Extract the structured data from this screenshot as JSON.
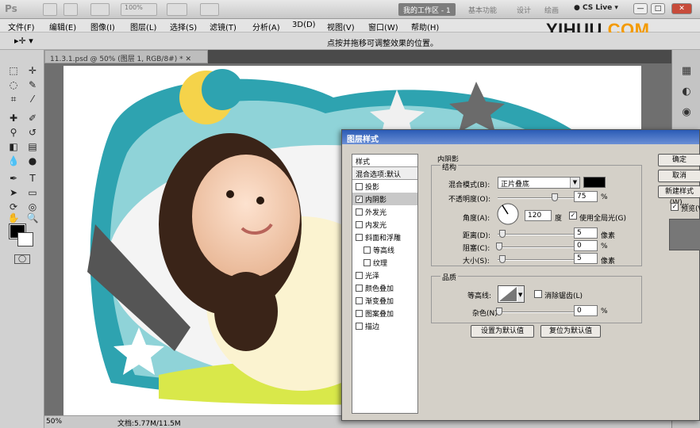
{
  "app": {
    "logo": "Ps",
    "zoom_box": "100%"
  },
  "workspaces": [
    "我的工作区 - 1",
    "基本功能",
    "设计",
    "绘画"
  ],
  "cslive": "CS Live",
  "window_buttons": [
    "—",
    "□",
    "✕"
  ],
  "menu": [
    "文件(F)",
    "编辑(E)",
    "图像(I)",
    "图层(L)",
    "选择(S)",
    "滤镜(T)",
    "分析(A)",
    "3D(D)",
    "视图(V)",
    "窗口(W)",
    "帮助(H)"
  ],
  "watermark": {
    "a": "YIHUU",
    "b": ".COM"
  },
  "options": {
    "hint": "点按并拖移可调整效果的位置。"
  },
  "doc": {
    "tab": "11.3.1.psd @ 50% (图层 1, RGB/8#) *",
    "zoom": "50%",
    "docsize": "文档:5.77M/11.5M"
  },
  "dialog": {
    "title": "图层样式",
    "list_head": "样式",
    "blend_default": "混合选项:默认",
    "items": [
      {
        "label": "投影",
        "checked": false,
        "sub": false,
        "selected": false
      },
      {
        "label": "内阴影",
        "checked": true,
        "sub": false,
        "selected": true
      },
      {
        "label": "外发光",
        "checked": false,
        "sub": false,
        "selected": false
      },
      {
        "label": "内发光",
        "checked": false,
        "sub": false,
        "selected": false
      },
      {
        "label": "斜面和浮雕",
        "checked": false,
        "sub": false,
        "selected": false
      },
      {
        "label": "等高线",
        "checked": false,
        "sub": true,
        "selected": false
      },
      {
        "label": "纹理",
        "checked": false,
        "sub": true,
        "selected": false
      },
      {
        "label": "光泽",
        "checked": false,
        "sub": false,
        "selected": false
      },
      {
        "label": "颜色叠加",
        "checked": false,
        "sub": false,
        "selected": false
      },
      {
        "label": "渐变叠加",
        "checked": false,
        "sub": false,
        "selected": false
      },
      {
        "label": "图案叠加",
        "checked": false,
        "sub": false,
        "selected": false
      },
      {
        "label": "描边",
        "checked": false,
        "sub": false,
        "selected": false
      }
    ],
    "section": "内阴影",
    "structure": "结构",
    "blend_mode_label": "混合模式(B):",
    "blend_mode": "正片叠底",
    "opacity_label": "不透明度(O):",
    "opacity": "75",
    "opacity_level": 0.75,
    "pct": "%",
    "angle_label": "角度(A):",
    "angle": "120",
    "degree": "度",
    "global_light": "使用全局光(G)",
    "distance_label": "距离(D):",
    "distance": "5",
    "choke_label": "阻塞(C):",
    "choke": "0",
    "size_label": "大小(S):",
    "size": "5",
    "px": "像素",
    "quality": "品质",
    "contour_label": "等高线:",
    "antialias": "消除锯齿(L)",
    "noise_label": "杂色(N):",
    "noise": "0",
    "set_default": "设置为默认值",
    "reset_default": "复位为默认值",
    "ok": "确定",
    "cancel": "取消",
    "new_style": "新建样式(W)...",
    "preview": "预览(V)"
  },
  "colors": {
    "accent": "#2a5bb5",
    "teal": "#2ea3b0",
    "shadow_color": "#000000"
  }
}
